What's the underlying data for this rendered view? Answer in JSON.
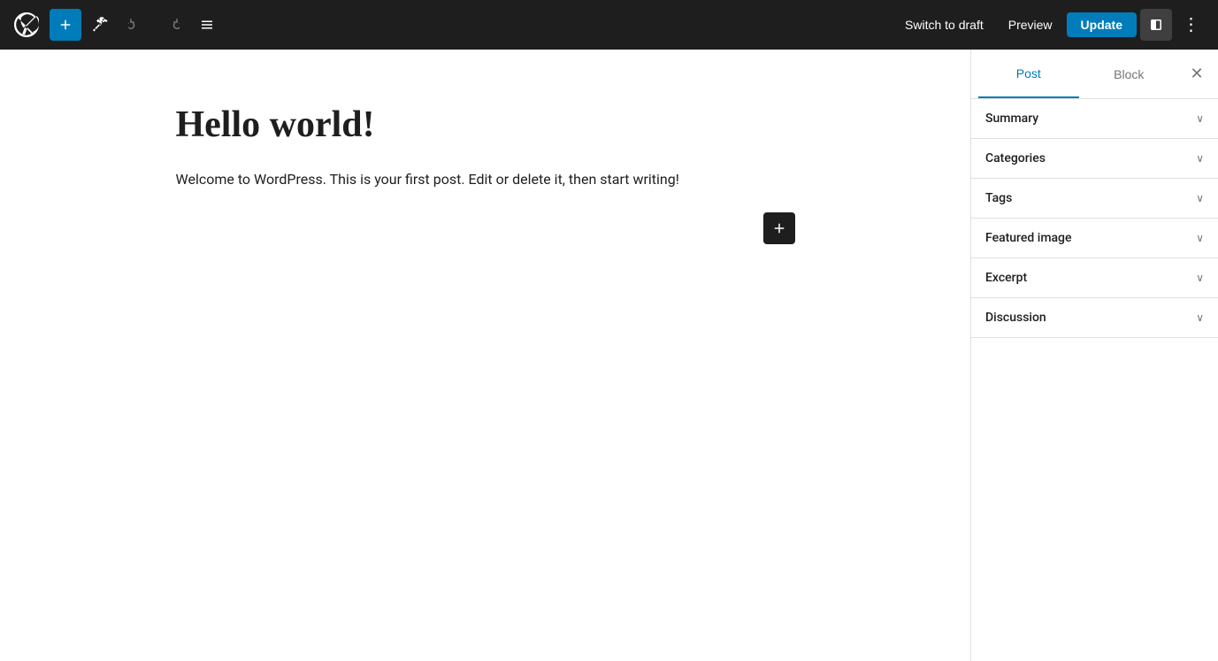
{
  "toolbar": {
    "wp_logo_title": "WordPress",
    "add_block_label": "+",
    "tools_label": "Tools",
    "undo_label": "Undo",
    "redo_label": "Redo",
    "document_overview_label": "Document Overview",
    "switch_to_draft_label": "Switch to draft",
    "preview_label": "Preview",
    "update_label": "Update",
    "more_options_label": "⋮"
  },
  "editor": {
    "post_title": "Hello world!",
    "post_body": "Welcome to WordPress. This is your first post. Edit or delete it, then start writing!"
  },
  "sidebar": {
    "post_tab_label": "Post",
    "block_tab_label": "Block",
    "close_label": "✕",
    "sections": [
      {
        "id": "summary",
        "label": "Summary"
      },
      {
        "id": "categories",
        "label": "Categories"
      },
      {
        "id": "tags",
        "label": "Tags"
      },
      {
        "id": "featured-image",
        "label": "Featured image"
      },
      {
        "id": "excerpt",
        "label": "Excerpt"
      },
      {
        "id": "discussion",
        "label": "Discussion"
      }
    ]
  }
}
